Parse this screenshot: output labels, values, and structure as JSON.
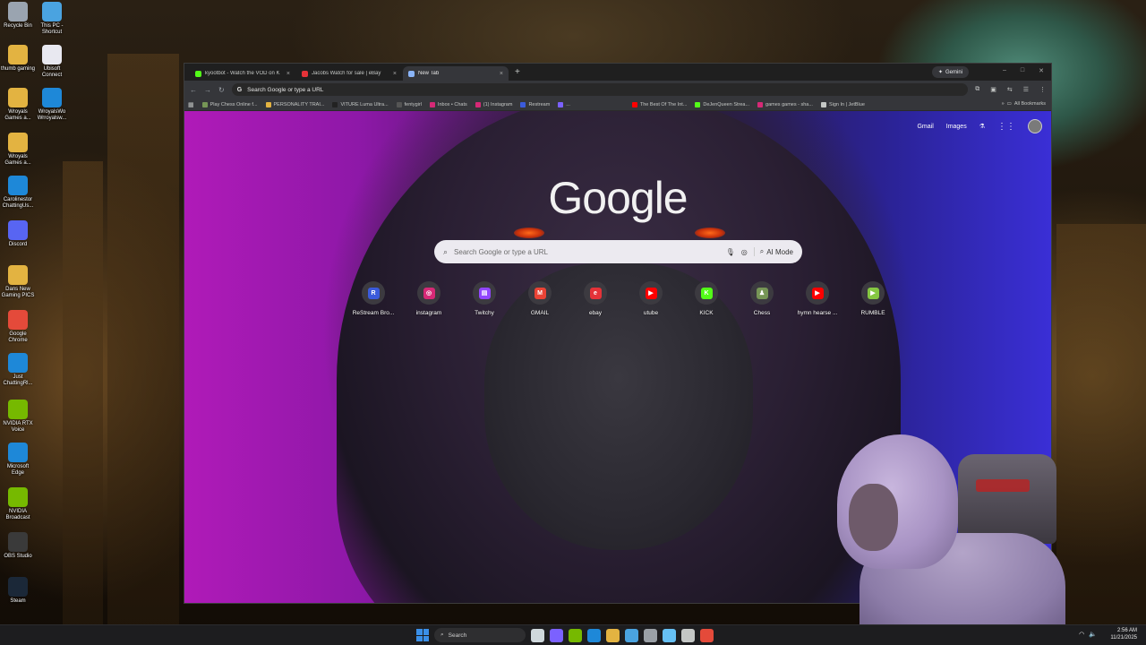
{
  "desktop": {
    "icons": [
      {
        "label": "Recycle Bin",
        "icon": "recycle-bin-icon",
        "color": "#9aa4b0"
      },
      {
        "label": "This PC - Shortcut",
        "icon": "computer-icon",
        "color": "#4aa3e0"
      },
      {
        "label": "thumb gaming",
        "icon": "folder-icon",
        "color": "#e3b341"
      },
      {
        "label": "Ubisoft Connect",
        "icon": "ubisoft-icon",
        "color": "#e8e8f0"
      },
      {
        "label": "Wroyals Games a...",
        "icon": "folder-icon",
        "color": "#e3b341"
      },
      {
        "label": "WroyalsWo Wrroyalsw...",
        "icon": "edge-icon",
        "color": "#1e88d8"
      },
      {
        "label": "Wroyals Games a...",
        "icon": "folder-icon",
        "color": "#e3b341"
      },
      {
        "label": "Carolinestor ChattingUs...",
        "icon": "edge-icon",
        "color": "#1e88d8"
      },
      {
        "label": "Discord",
        "icon": "discord-icon",
        "color": "#5865f2"
      },
      {
        "label": "Dans New Gaming PICS",
        "icon": "folder-icon",
        "color": "#e3b341"
      },
      {
        "label": "Google Chrome",
        "icon": "chrome-icon",
        "color": "#e44a3a"
      },
      {
        "label": "Just ChattingRl...",
        "icon": "edge-icon",
        "color": "#1e88d8"
      },
      {
        "label": "NVIDIA RTX Voice",
        "icon": "nvidia-icon",
        "color": "#76b900"
      },
      {
        "label": "Microsoft Edge",
        "icon": "edge-icon",
        "color": "#1e88d8"
      },
      {
        "label": "NVIDIA Broadcast",
        "icon": "nvidia-icon",
        "color": "#76b900"
      },
      {
        "label": "OBS Studio",
        "icon": "obs-icon",
        "color": "#3a3a3a"
      },
      {
        "label": "Steam",
        "icon": "steam-icon",
        "color": "#1b2838"
      }
    ]
  },
  "browser": {
    "tabs": [
      {
        "title": "kyootbot - Watch the VOD on K",
        "close": "×",
        "favicon": "kick-icon",
        "color": "#53fc18",
        "active": false
      },
      {
        "title": "Jacobs Watch for sale | eBay",
        "close": "×",
        "favicon": "ebay-icon",
        "color": "#e53238",
        "active": false
      },
      {
        "title": "New Tab",
        "close": "×",
        "favicon": "chrome-icon",
        "color": "#8ab4f8",
        "active": true
      }
    ],
    "new_tab": "+",
    "gemini_label": "Gemini",
    "window_controls": {
      "minimize": "–",
      "maximize": "□",
      "close": "✕"
    },
    "toolbar": {
      "back": "←",
      "forward": "→",
      "reload": "↻",
      "omnibox_text": "Search Google or type a URL",
      "omnibox_g": "G",
      "extensions": [
        "⧉",
        "▣",
        "⇆",
        "☰",
        "⋮"
      ]
    },
    "bookmarks": [
      {
        "label": "Play Chess Online f...",
        "color": "#769656"
      },
      {
        "label": "PERSONALITY TRAI...",
        "color": "#e3b341"
      },
      {
        "label": "VITURE Luma Ultra...",
        "color": "#222222"
      },
      {
        "label": "fentygirl",
        "color": "#555555"
      },
      {
        "label": "Inbox • Chats",
        "color": "#d62976"
      },
      {
        "label": "(1) Instagram",
        "color": "#d62976"
      },
      {
        "label": "Restream",
        "color": "#3b5bdb"
      },
      {
        "label": "...",
        "color": "#7b61ff"
      },
      {
        "label": "The Best Of The Int...",
        "color": "#ff0000"
      },
      {
        "label": "DeJenQueen Strea...",
        "color": "#53fc18"
      },
      {
        "label": "games games - sha...",
        "color": "#d62976"
      },
      {
        "label": "Sign In | JetBlue",
        "color": "#c4c7c5"
      }
    ],
    "all_bookmarks": "All Bookmarks",
    "overflow": "»"
  },
  "ntp": {
    "links": {
      "gmail": "Gmail",
      "images": "Images"
    },
    "logo": "Google",
    "search_placeholder": "Search Google or type a URL",
    "ai_mode": "AI Mode",
    "shortcuts": [
      {
        "label": "ReStream Bro...",
        "letter": "R",
        "color": "#3b5bdb"
      },
      {
        "label": "instagram",
        "letter": "◎",
        "color": "#d62976"
      },
      {
        "label": "Twitchy",
        "letter": "▤",
        "color": "#9146ff"
      },
      {
        "label": "GMAIL",
        "letter": "M",
        "color": "#ea4335"
      },
      {
        "label": "ebay",
        "letter": "e",
        "color": "#e53238"
      },
      {
        "label": "utube",
        "letter": "▶",
        "color": "#ff0000"
      },
      {
        "label": "KICK",
        "letter": "K",
        "color": "#53fc18"
      },
      {
        "label": "Chess",
        "letter": "♟",
        "color": "#769656"
      },
      {
        "label": "hymn hearse ...",
        "letter": "▶",
        "color": "#ff0000"
      },
      {
        "label": "RUMBLE",
        "letter": "▶",
        "color": "#85c742"
      }
    ]
  },
  "taskbar": {
    "search_label": "Search",
    "apps": [
      {
        "icon": "task-view-icon",
        "color": "#cfd8dc"
      },
      {
        "icon": "copilot-icon",
        "color": "#7b61ff"
      },
      {
        "icon": "headset-icon",
        "color": "#76b900"
      },
      {
        "icon": "edge-icon",
        "color": "#1e88d8"
      },
      {
        "icon": "file-explorer-icon",
        "color": "#e3b341"
      },
      {
        "icon": "store-icon",
        "color": "#4aa3e0"
      },
      {
        "icon": "settings-icon",
        "color": "#9aa0a6"
      },
      {
        "icon": "steam-icon",
        "color": "#66c0f4"
      },
      {
        "icon": "obs-icon",
        "color": "#c4c7c5"
      },
      {
        "icon": "chrome-icon",
        "color": "#e44a3a"
      }
    ],
    "clock_time": "2:56 AM",
    "clock_date": "11/21/2025"
  }
}
